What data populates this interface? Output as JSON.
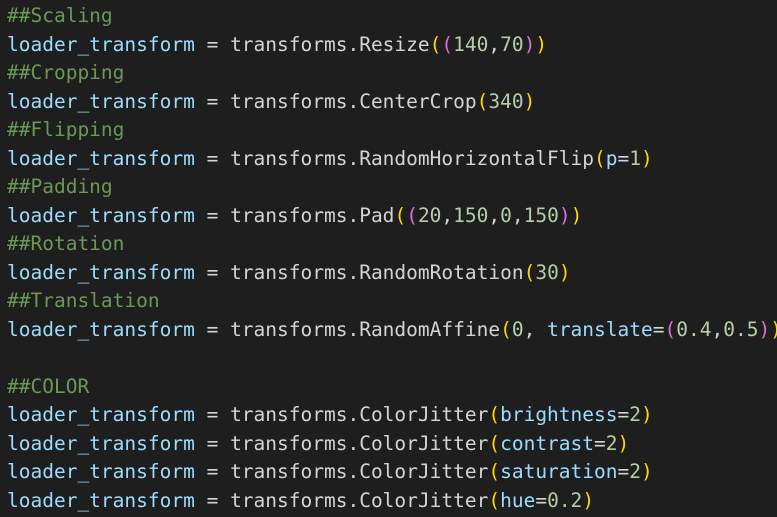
{
  "colors": {
    "background": "#1e1e1e",
    "comment": "#6a9955",
    "variable": "#9cdcfe",
    "number": "#b5cea8",
    "bracket_level1": "#ffd700",
    "bracket_level2": "#da70d6"
  },
  "lines": [
    [
      {
        "t": "##Scaling",
        "c": "comment"
      }
    ],
    [
      {
        "t": "loader_transform",
        "c": "var"
      },
      {
        "t": " = transforms.Resize",
        "c": "op"
      },
      {
        "t": "(",
        "c": "b1"
      },
      {
        "t": "(",
        "c": "b2"
      },
      {
        "t": "140",
        "c": "num"
      },
      {
        "t": ",",
        "c": "op"
      },
      {
        "t": "70",
        "c": "num"
      },
      {
        "t": ")",
        "c": "b2"
      },
      {
        "t": ")",
        "c": "b1"
      }
    ],
    [
      {
        "t": "##Cropping",
        "c": "comment"
      }
    ],
    [
      {
        "t": "loader_transform",
        "c": "var"
      },
      {
        "t": " = transforms.CenterCrop",
        "c": "op"
      },
      {
        "t": "(",
        "c": "b1"
      },
      {
        "t": "340",
        "c": "num"
      },
      {
        "t": ")",
        "c": "b1"
      }
    ],
    [
      {
        "t": "##Flipping",
        "c": "comment"
      }
    ],
    [
      {
        "t": "loader_transform",
        "c": "var"
      },
      {
        "t": " = transforms.RandomHorizontalFlip",
        "c": "op"
      },
      {
        "t": "(",
        "c": "b1"
      },
      {
        "t": "p",
        "c": "param"
      },
      {
        "t": "=",
        "c": "op"
      },
      {
        "t": "1",
        "c": "num"
      },
      {
        "t": ")",
        "c": "b1"
      }
    ],
    [
      {
        "t": "##Padding",
        "c": "comment"
      }
    ],
    [
      {
        "t": "loader_transform",
        "c": "var"
      },
      {
        "t": " = transforms.Pad",
        "c": "op"
      },
      {
        "t": "(",
        "c": "b1"
      },
      {
        "t": "(",
        "c": "b2"
      },
      {
        "t": "20",
        "c": "num"
      },
      {
        "t": ",",
        "c": "op"
      },
      {
        "t": "150",
        "c": "num"
      },
      {
        "t": ",",
        "c": "op"
      },
      {
        "t": "0",
        "c": "num"
      },
      {
        "t": ",",
        "c": "op"
      },
      {
        "t": "150",
        "c": "num"
      },
      {
        "t": ")",
        "c": "b2"
      },
      {
        "t": ")",
        "c": "b1"
      }
    ],
    [
      {
        "t": "##Rotation",
        "c": "comment"
      }
    ],
    [
      {
        "t": "loader_transform",
        "c": "var"
      },
      {
        "t": " = transforms.RandomRotation",
        "c": "op"
      },
      {
        "t": "(",
        "c": "b1"
      },
      {
        "t": "30",
        "c": "num"
      },
      {
        "t": ")",
        "c": "b1"
      }
    ],
    [
      {
        "t": "##Translation",
        "c": "comment"
      }
    ],
    [
      {
        "t": "loader_transform",
        "c": "var"
      },
      {
        "t": " = transforms.RandomAffine",
        "c": "op"
      },
      {
        "t": "(",
        "c": "b1"
      },
      {
        "t": "0",
        "c": "num"
      },
      {
        "t": ", ",
        "c": "op"
      },
      {
        "t": "translate",
        "c": "param"
      },
      {
        "t": "=",
        "c": "op"
      },
      {
        "t": "(",
        "c": "b2"
      },
      {
        "t": "0.4",
        "c": "num"
      },
      {
        "t": ",",
        "c": "op"
      },
      {
        "t": "0.5",
        "c": "num"
      },
      {
        "t": ")",
        "c": "b2"
      },
      {
        "t": ")",
        "c": "b1"
      }
    ],
    [],
    [
      {
        "t": "##COLOR",
        "c": "comment"
      }
    ],
    [
      {
        "t": "loader_transform",
        "c": "var"
      },
      {
        "t": " = transforms.ColorJitter",
        "c": "op"
      },
      {
        "t": "(",
        "c": "b1"
      },
      {
        "t": "brightness",
        "c": "param"
      },
      {
        "t": "=",
        "c": "op"
      },
      {
        "t": "2",
        "c": "num"
      },
      {
        "t": ")",
        "c": "b1"
      }
    ],
    [
      {
        "t": "loader_transform",
        "c": "var"
      },
      {
        "t": " = transforms.ColorJitter",
        "c": "op"
      },
      {
        "t": "(",
        "c": "b1"
      },
      {
        "t": "contrast",
        "c": "param"
      },
      {
        "t": "=",
        "c": "op"
      },
      {
        "t": "2",
        "c": "num"
      },
      {
        "t": ")",
        "c": "b1"
      }
    ],
    [
      {
        "t": "loader_transform",
        "c": "var"
      },
      {
        "t": " = transforms.ColorJitter",
        "c": "op"
      },
      {
        "t": "(",
        "c": "b1"
      },
      {
        "t": "saturation",
        "c": "param"
      },
      {
        "t": "=",
        "c": "op"
      },
      {
        "t": "2",
        "c": "num"
      },
      {
        "t": ")",
        "c": "b1"
      }
    ],
    [
      {
        "t": "loader_transform",
        "c": "var"
      },
      {
        "t": " = transforms.ColorJitter",
        "c": "op"
      },
      {
        "t": "(",
        "c": "b1"
      },
      {
        "t": "hue",
        "c": "param"
      },
      {
        "t": "=",
        "c": "op"
      },
      {
        "t": "0.2",
        "c": "num"
      },
      {
        "t": ")",
        "c": "b1"
      }
    ]
  ]
}
